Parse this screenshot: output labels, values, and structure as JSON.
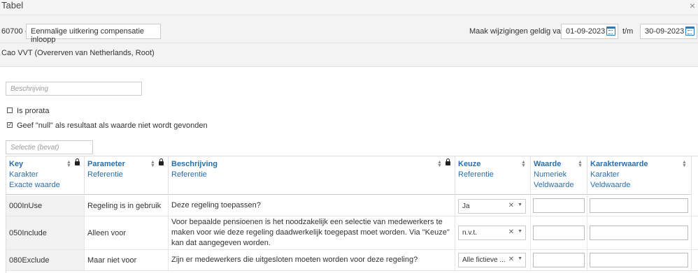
{
  "window": {
    "title": "Tabel"
  },
  "header": {
    "code": "60700 -",
    "name": "Eenmalige uitkering compensatie inloopp",
    "valid_label": "Maak wijzigingen geldig van",
    "date_from": "01-09-2023",
    "tm_label": "t/m",
    "date_to": "30-09-2023"
  },
  "subheader": {
    "text": "Cao VVT (Overerven van Netherlands, Root)"
  },
  "description_input": {
    "placeholder": "Beschrijving"
  },
  "checkboxes": [
    {
      "label": "Is prorata",
      "checked": false
    },
    {
      "label": "Geef \"null\" als resultaat als waarde niet wordt gevonden",
      "checked": true
    }
  ],
  "filter_input": {
    "placeholder": "Selectie (bevat)"
  },
  "table": {
    "columns": [
      {
        "title": "Key",
        "sub1": "Karakter",
        "sub2": "Exacte waarde",
        "locked": true
      },
      {
        "title": "Parameter",
        "sub1": "Referentie",
        "sub2": "",
        "locked": true
      },
      {
        "title": "Beschrijving",
        "sub1": "Referentie",
        "sub2": "",
        "locked": true
      },
      {
        "title": "Keuze",
        "sub1": "Referentie",
        "sub2": "",
        "locked": false
      },
      {
        "title": "Waarde",
        "sub1": "Numeriek",
        "sub2": "Veldwaarde",
        "locked": false
      },
      {
        "title": "Karakterwaarde",
        "sub1": "Karakter",
        "sub2": "Veldwaarde",
        "locked": false
      }
    ],
    "rows": [
      {
        "key": "000InUse",
        "parameter": "Regeling is in gebruik",
        "description": "Deze regeling toepassen?",
        "choice": "Ja",
        "waarde": "",
        "karakterwaarde": ""
      },
      {
        "key": "050Include",
        "parameter": "Alleen voor",
        "description": "Voor bepaalde pensioenen is het noodzakelijk een selectie van medewerkers te maken voor wie deze regeling daadwerkelijk toegepast moet worden. Via \"Keuze\" kan dat aangegeven worden.",
        "choice": "n.v.t.",
        "waarde": "",
        "karakterwaarde": ""
      },
      {
        "key": "080Exclude",
        "parameter": "Maar niet voor",
        "description": "Zijn er medewerkers die uitgesloten moeten worden voor deze regeling?",
        "choice": "Alle fictieve ...",
        "waarde": "",
        "karakterwaarde": ""
      }
    ]
  },
  "icons": {
    "close": "close-icon",
    "calendar": "calendar-icon",
    "lock": "lock-icon",
    "sort": "sort-icon",
    "clear": "clear-icon",
    "caret": "chevron-down-icon"
  },
  "colors": {
    "header_link": "#2a6fab",
    "calendar": "#2a78b8"
  }
}
